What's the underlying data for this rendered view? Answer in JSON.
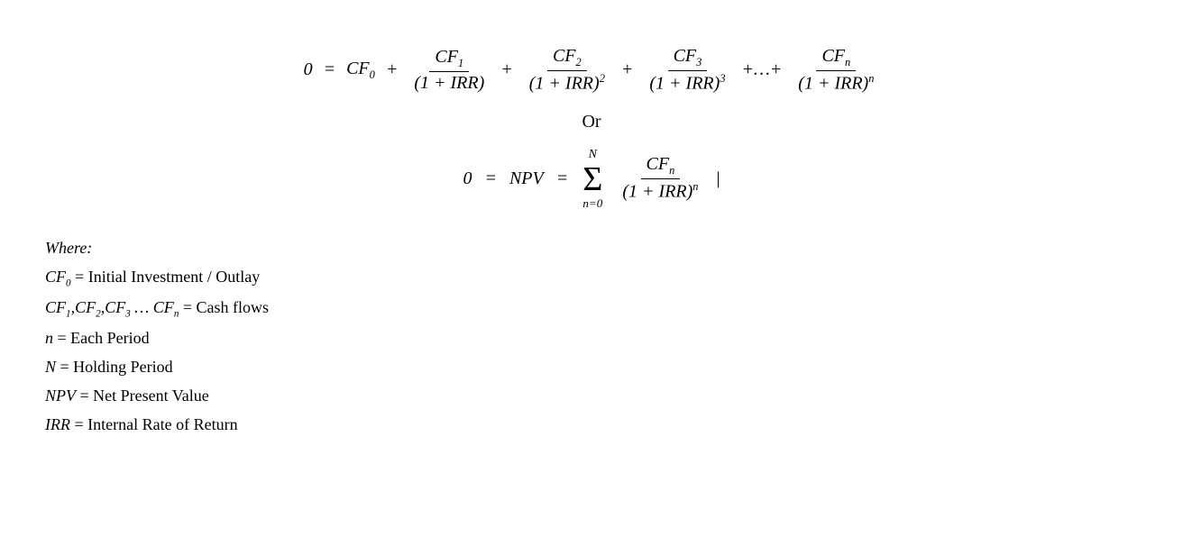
{
  "formula1": {
    "zero": "0",
    "equals": "=",
    "cf0": "CF",
    "cf0_sub": "0",
    "plus1": "+",
    "cf1_num": "CF",
    "cf1_sub": "1",
    "denom1_base": "(1 + IRR)",
    "plus2": "+",
    "cf2_num": "CF",
    "cf2_sub": "2",
    "denom2_base": "(1 + IRR)",
    "denom2_exp": "2",
    "plus3": "+",
    "cf3_num": "CF",
    "cf3_sub": "3",
    "denom3_base": "(1 + IRR)",
    "denom3_exp": "3",
    "ellipsis": "+…+",
    "cfn_num": "CF",
    "cfn_sub": "n",
    "denomn_base": "(1 + IRR)",
    "denomn_exp": "n"
  },
  "or_text": "Or",
  "formula2": {
    "zero": "0",
    "equals1": "=",
    "npv": "NPV",
    "equals2": "=",
    "sum_upper": "N",
    "sum_symbol": "Σ",
    "sum_lower": "n=0",
    "cfn_num": "CF",
    "cfn_sub": "n",
    "denom_base": "(1 + IRR)",
    "denom_exp": "n"
  },
  "where_section": {
    "title": "Where:",
    "line1_var": "CF",
    "line1_sub": "0",
    "line1_text": " = Initial Investment / Outlay",
    "line2_var": "CF",
    "line2_sub1": "1",
    "line2_comma1": ",",
    "line2_var2": "CF",
    "line2_sub2": "2",
    "line2_comma2": ",",
    "line2_var3": "CF",
    "line2_sub3": "3",
    "line2_dots": " … ",
    "line2_var4": "CF",
    "line2_sub4": "n",
    "line2_text": " = Cash flows",
    "line3_var": "n",
    "line3_text": " = Each Period",
    "line4_var": "N",
    "line4_text": " = Holding Period",
    "line5_var": "NPV",
    "line5_text": " = Net Present Value",
    "line6_var": "IRR",
    "line6_text": " = Internal Rate of Return"
  }
}
